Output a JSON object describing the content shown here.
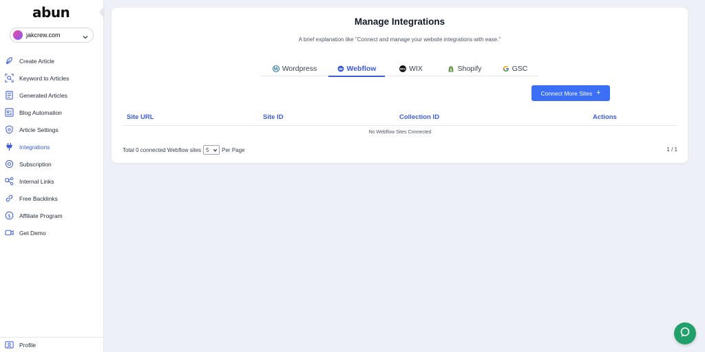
{
  "app": {
    "logo": "abun",
    "site": "jakcrew.com"
  },
  "colors": {
    "accent": "#3b5bdb",
    "button": "#3b6ff5",
    "chat": "#22a06b",
    "background": "#eef0f7"
  },
  "sidebar": {
    "items": [
      {
        "label": "Create Article",
        "icon": "feather-icon"
      },
      {
        "label": "Keyword to Articles",
        "icon": "keyword-scan-icon"
      },
      {
        "label": "Generated Articles",
        "icon": "document-icon"
      },
      {
        "label": "Blog Automation",
        "icon": "automation-icon"
      },
      {
        "label": "Article Settings",
        "icon": "shield-settings-icon"
      },
      {
        "label": "Integrations",
        "icon": "plug-icon",
        "active": true
      },
      {
        "label": "Subscription",
        "icon": "subscription-icon"
      },
      {
        "label": "Internal Links",
        "icon": "internal-links-icon"
      },
      {
        "label": "Free Backlinks",
        "icon": "link-icon"
      },
      {
        "label": "Affiliate Program",
        "icon": "dollar-icon"
      },
      {
        "label": "Get Demo",
        "icon": "video-camera-icon"
      }
    ],
    "profile_label": "Profile"
  },
  "main": {
    "title": "Manage Integrations",
    "subtitle": "A brief explanation like \"Connect and manage your website integrations with ease.\"",
    "tabs": [
      {
        "label": "Wordpress",
        "icon": "wordpress-icon"
      },
      {
        "label": "Webflow",
        "icon": "webflow-icon",
        "active": true
      },
      {
        "label": "WIX",
        "icon": "wix-icon"
      },
      {
        "label": "Shopify",
        "icon": "shopify-icon"
      },
      {
        "label": "GSC",
        "icon": "google-icon"
      }
    ],
    "connect_button": "Connect More Sites",
    "table": {
      "columns": [
        "Site URL",
        "Site ID",
        "Collection ID",
        "Actions"
      ],
      "empty_message": "No Webflow Sites Connected"
    },
    "footer": {
      "total_text": "Total 0 connected Webflow sites",
      "per_page_value": "5",
      "per_page_label": "Per Page",
      "page_indicator": "1 / 1"
    }
  }
}
